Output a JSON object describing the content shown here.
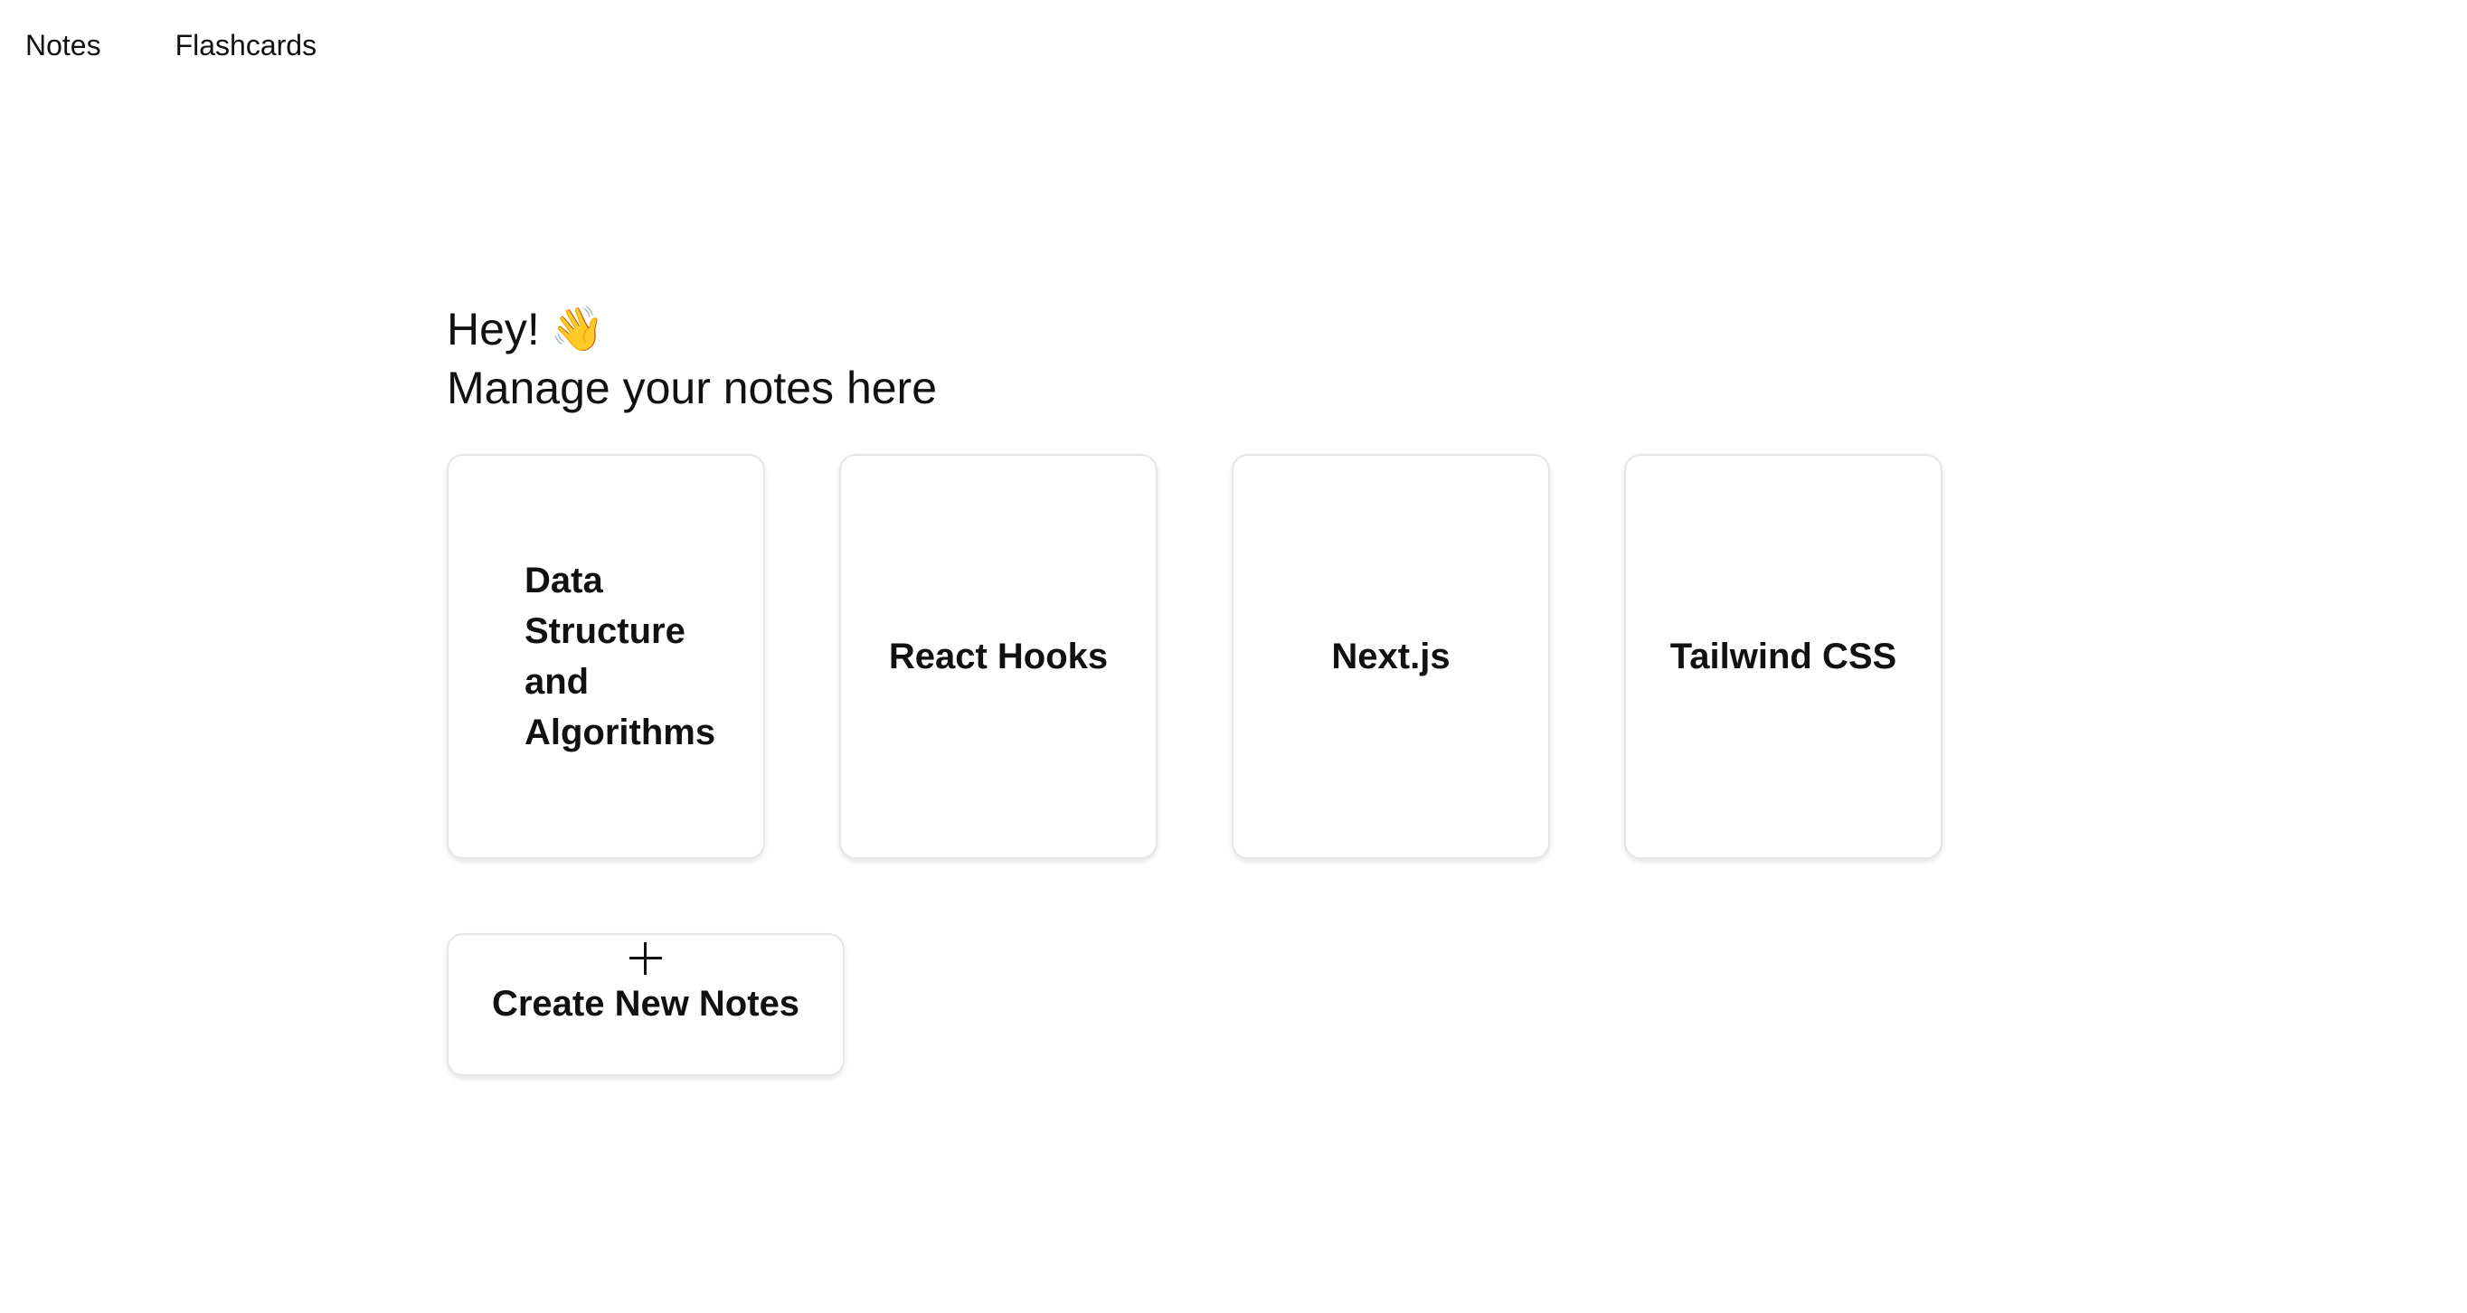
{
  "nav": {
    "items": [
      {
        "label": "Notes"
      },
      {
        "label": "Flashcards"
      }
    ]
  },
  "header": {
    "greeting": "Hey!",
    "greeting_emoji": "👋",
    "subtitle": "Manage your notes here"
  },
  "notes": [
    {
      "title": "Data Structure and Algorithms"
    },
    {
      "title": "React Hooks"
    },
    {
      "title": "Next.js"
    },
    {
      "title": "Tailwind CSS"
    }
  ],
  "create": {
    "icon": "plus-icon",
    "label": "Create New Notes"
  }
}
